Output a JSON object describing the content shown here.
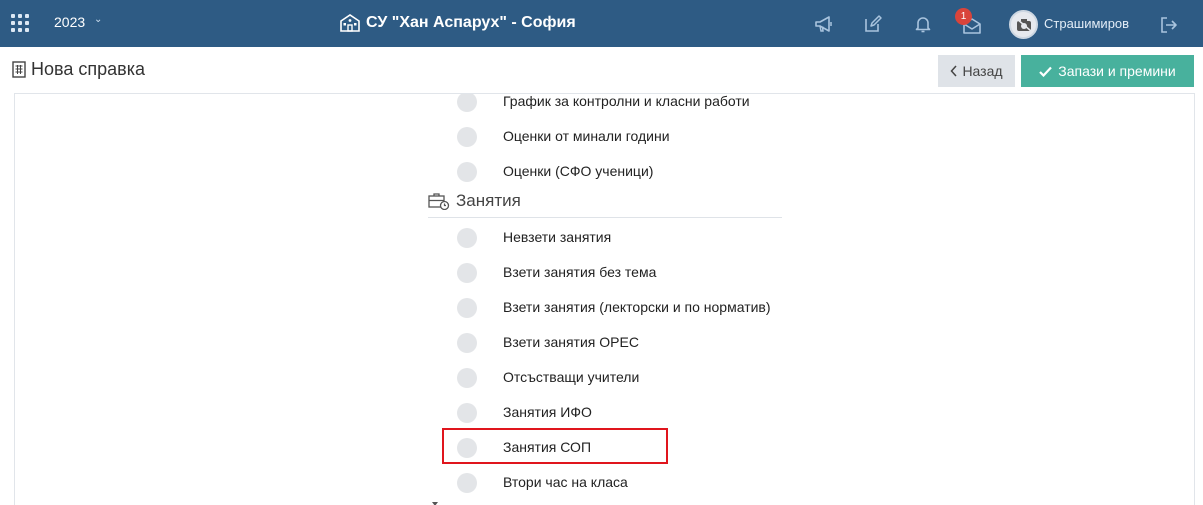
{
  "header": {
    "year": "2023",
    "school_name": "СУ \"Хан Аспарух\" - София",
    "notification_count": "1",
    "username": "Страшимиров",
    "icons": [
      "apps-grid-icon",
      "chevron-down-icon",
      "school-building-icon",
      "megaphone-icon",
      "edit-icon",
      "bell-icon",
      "mail-icon",
      "avatar",
      "logout-icon"
    ]
  },
  "page": {
    "title": "Нова справка",
    "back_label": "Назад",
    "save_label": "Запази и премини"
  },
  "report_options": [
    "График за контролни и класни работи",
    "Оценки от минали години",
    "Оценки (СФО ученици)"
  ],
  "section": {
    "title": "Занятия",
    "items": [
      "Невзети занятия",
      "Взети занятия без тема",
      "Взети занятия (лекторски и по норматив)",
      "Взети занятия ОРЕС",
      "Отсъстващи учители",
      "Занятия ИФО",
      "Занятия СОП",
      "Втори час на класа"
    ]
  },
  "colors": {
    "topbar": "#2e5b84",
    "save_button": "#48b19d",
    "back_button": "#dfe3e8",
    "badge": "#d9443b",
    "highlight": "#e0151d"
  }
}
